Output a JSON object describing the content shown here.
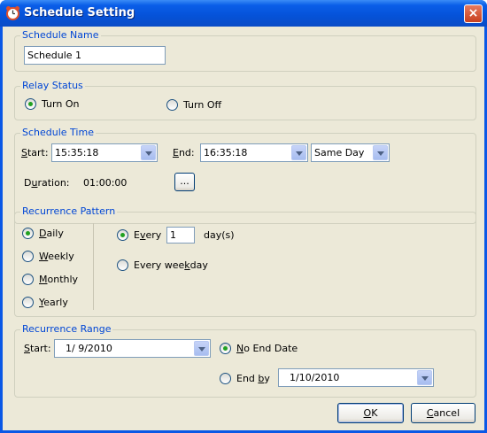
{
  "window": {
    "title": "Schedule Setting",
    "close_label": "×"
  },
  "schedule_name": {
    "group_label": "Schedule Name",
    "value": "Schedule 1"
  },
  "relay_status": {
    "group_label": "Relay Status",
    "turn_on": "Turn On",
    "turn_off": "Turn Off",
    "selected": "turn_on"
  },
  "schedule_time": {
    "group_label": "Schedule Time",
    "start_label": "Start:",
    "start_value": "15:35:18",
    "end_label": "End:",
    "end_value": "16:35:18",
    "day_value": "Same Day",
    "duration_label": "Duration:",
    "duration_value": "01:00:00",
    "browse_label": "..."
  },
  "recurrence_pattern": {
    "group_label": "Recurrence Pattern",
    "daily": "Daily",
    "weekly": "Weekly",
    "monthly": "Monthly",
    "yearly": "Yearly",
    "selected": "daily",
    "every_label": "Every",
    "every_value": "1",
    "days_label": "day(s)",
    "every_weekday_label": "Every weekday"
  },
  "recurrence_range": {
    "group_label": "Recurrence Range",
    "start_label": "Start:",
    "start_value": "1/ 9/2010",
    "no_end_label": "No End Date",
    "end_by_label": "End by",
    "end_by_value": "1/10/2010",
    "selected": "no_end"
  },
  "buttons": {
    "ok": "OK",
    "cancel": "Cancel"
  },
  "colors": {
    "group_label": "#0046d5",
    "titlebar": "#0a5ee8",
    "background": "#ece9d8"
  }
}
